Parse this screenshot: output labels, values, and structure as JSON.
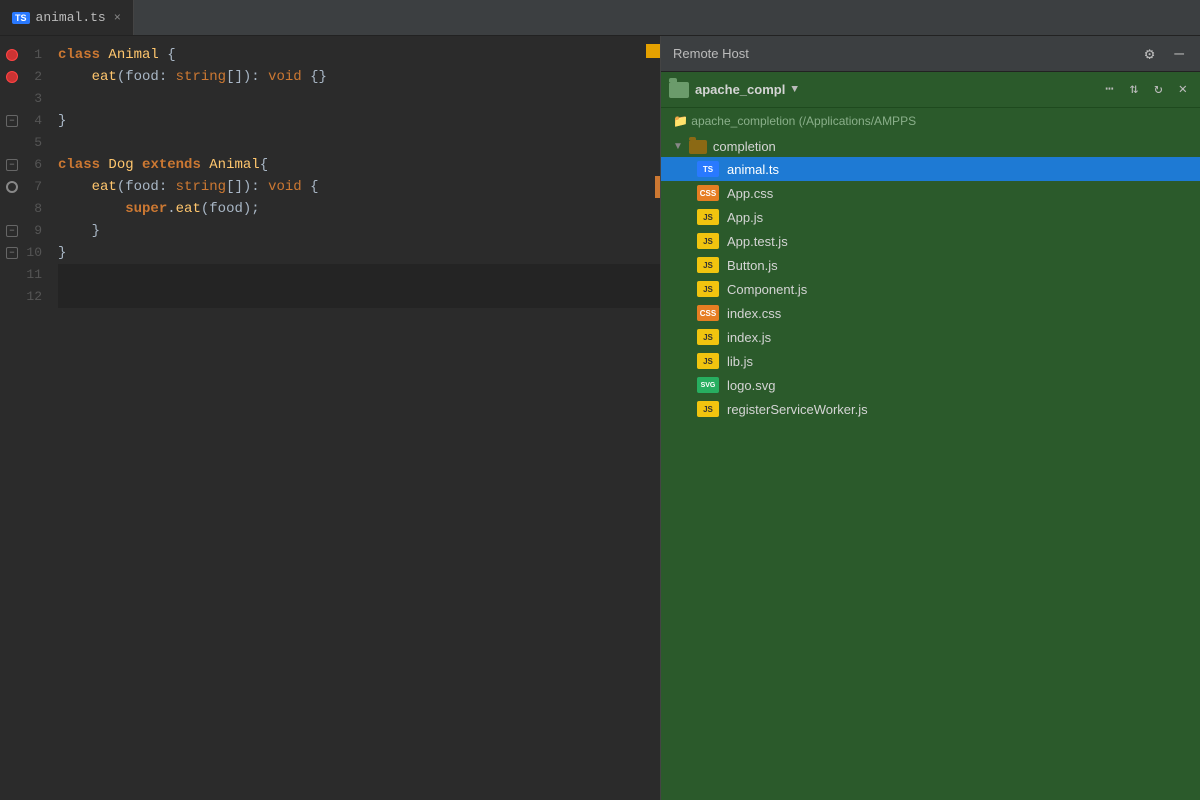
{
  "tab": {
    "label": "animal.ts",
    "close": "×",
    "badge": "TS"
  },
  "remote_panel": {
    "title": "Remote Host",
    "folder_label": "apache_compl",
    "path": "apache_completion (/Applications/AMPPS",
    "folders": [
      {
        "name": "completion",
        "expanded": true
      }
    ],
    "files": [
      {
        "name": "animal.ts",
        "type": "ts",
        "selected": true
      },
      {
        "name": "App.css",
        "type": "css"
      },
      {
        "name": "App.js",
        "type": "js"
      },
      {
        "name": "App.test.js",
        "type": "js"
      },
      {
        "name": "Button.js",
        "type": "js"
      },
      {
        "name": "Component.js",
        "type": "js"
      },
      {
        "name": "index.css",
        "type": "css"
      },
      {
        "name": "index.js",
        "type": "js"
      },
      {
        "name": "lib.js",
        "type": "js"
      },
      {
        "name": "logo.svg",
        "type": "svg"
      },
      {
        "name": "registerServiceWorker.js",
        "type": "js"
      }
    ]
  },
  "code": {
    "lines": [
      {
        "num": 1,
        "gutter": "breakpoint",
        "text": "class Animal {",
        "tokens": [
          {
            "t": "kw",
            "v": "class"
          },
          {
            "t": "txt",
            "v": " "
          },
          {
            "t": "cn",
            "v": "Animal"
          },
          {
            "t": "txt",
            "v": " {"
          }
        ]
      },
      {
        "num": 2,
        "gutter": "breakpoint",
        "text": "    eat(food: string[]): void {}",
        "tokens": [
          {
            "t": "txt",
            "v": "    "
          },
          {
            "t": "fn",
            "v": "eat"
          },
          {
            "t": "txt",
            "v": "(food: "
          },
          {
            "t": "kw2",
            "v": "string"
          },
          {
            "t": "txt",
            "v": "[]): "
          },
          {
            "t": "kw2",
            "v": "void"
          },
          {
            "t": "txt",
            "v": " {}"
          }
        ]
      },
      {
        "num": 3,
        "gutter": "",
        "text": ""
      },
      {
        "num": 4,
        "gutter": "fold",
        "text": "}",
        "tokens": [
          {
            "t": "txt",
            "v": "}"
          }
        ]
      },
      {
        "num": 5,
        "gutter": "",
        "text": ""
      },
      {
        "num": 6,
        "gutter": "fold",
        "text": "class Dog extends Animal{",
        "tokens": [
          {
            "t": "kw",
            "v": "class"
          },
          {
            "t": "txt",
            "v": " "
          },
          {
            "t": "cn",
            "v": "Dog"
          },
          {
            "t": "txt",
            "v": " "
          },
          {
            "t": "kw",
            "v": "extends"
          },
          {
            "t": "txt",
            "v": " "
          },
          {
            "t": "cn",
            "v": "Animal"
          },
          {
            "t": "txt",
            "v": "{"
          }
        ]
      },
      {
        "num": 7,
        "gutter": "breakpoint-muted",
        "text": "    eat(food: string[]): void {",
        "tokens": [
          {
            "t": "txt",
            "v": "    "
          },
          {
            "t": "fn",
            "v": "eat"
          },
          {
            "t": "txt",
            "v": "(food: "
          },
          {
            "t": "kw2",
            "v": "string"
          },
          {
            "t": "txt",
            "v": "[]): "
          },
          {
            "t": "kw2",
            "v": "void"
          },
          {
            "t": "txt",
            "v": " {"
          }
        ]
      },
      {
        "num": 8,
        "gutter": "",
        "text": "        super.eat(food);",
        "tokens": [
          {
            "t": "txt",
            "v": "        "
          },
          {
            "t": "super-kw",
            "v": "super"
          },
          {
            "t": "txt",
            "v": "."
          },
          {
            "t": "method",
            "v": "eat"
          },
          {
            "t": "txt",
            "v": "(food);"
          }
        ]
      },
      {
        "num": 9,
        "gutter": "fold",
        "text": "    }",
        "tokens": [
          {
            "t": "txt",
            "v": "    }"
          }
        ]
      },
      {
        "num": 10,
        "gutter": "fold",
        "text": "}",
        "tokens": [
          {
            "t": "txt",
            "v": "}"
          }
        ]
      },
      {
        "num": 11,
        "gutter": "",
        "text": ""
      },
      {
        "num": 12,
        "gutter": "",
        "text": ""
      }
    ]
  }
}
